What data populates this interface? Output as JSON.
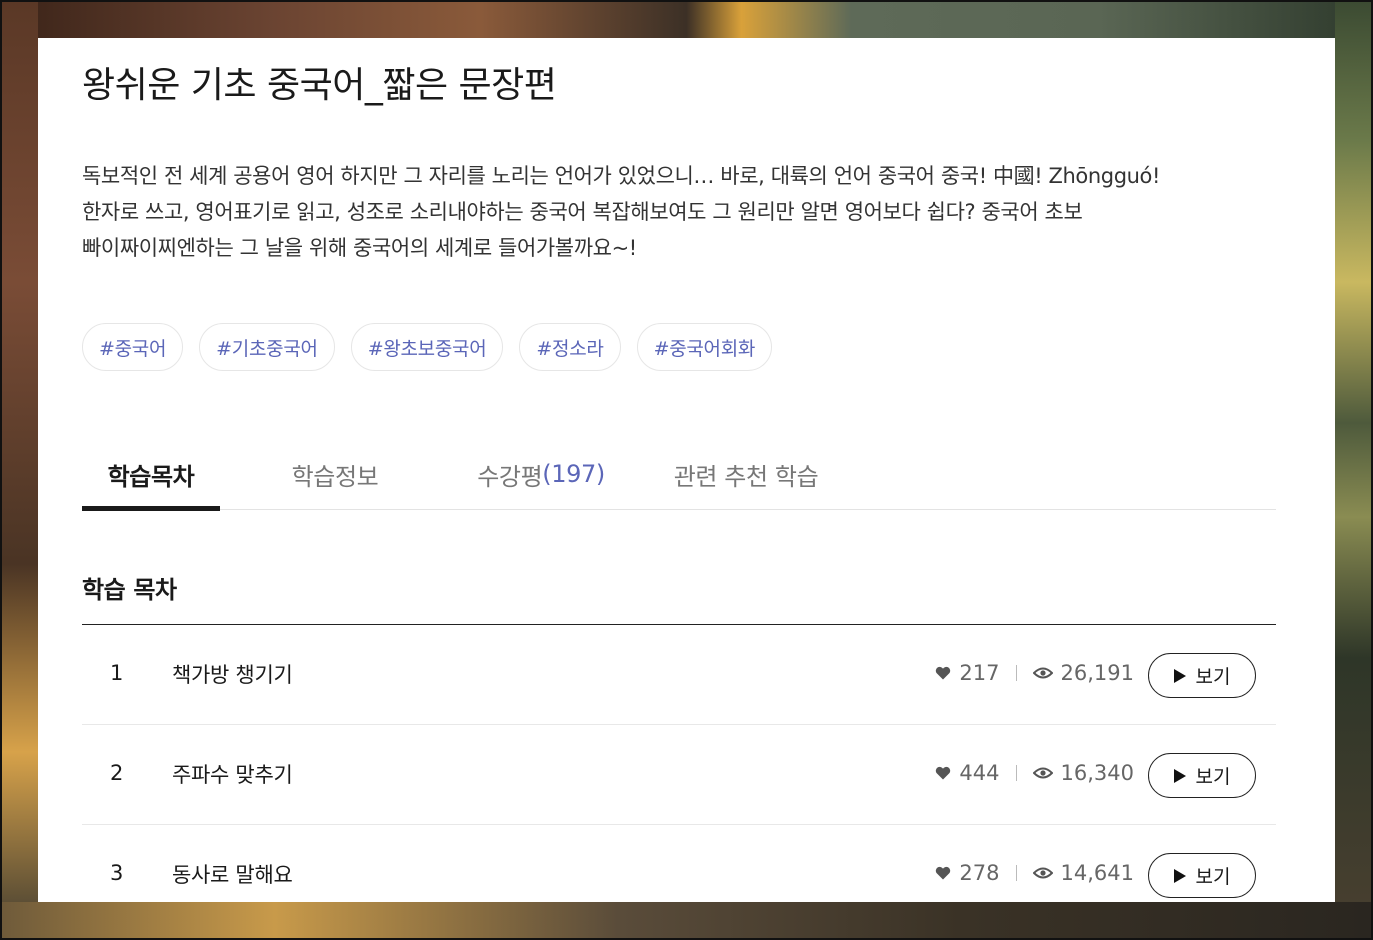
{
  "course": {
    "title": "왕쉬운 기초 중국어_짧은 문장편",
    "description_lines": [
      "독보적인 전 세계 공용어 영어 하지만 그 자리를 노리는 언어가 있었으니… 바로, 대륙의 언어 중국어 중국! 中國! Zhōngguó!",
      "한자로 쓰고, 영어표기로 읽고, 성조로 소리내야하는 중국어 복잡해보여도 그 원리만 알면 영어보다 쉽다? 중국어 초보",
      "빠이짜이찌엔하는 그 날을 위해 중국어의 세계로 들어가볼까요~!"
    ],
    "tags": [
      "#중국어",
      "#기초중국어",
      "#왕초보중국어",
      "#정소라",
      "#중국어회화"
    ]
  },
  "tabs": {
    "toc": "학습목차",
    "info": "학습정보",
    "reviews_label": "수강평",
    "reviews_count": "(197)",
    "related": "관련 추천 학습"
  },
  "toc": {
    "heading": "학습 목차",
    "view_label": "보기",
    "items": [
      {
        "num": "1",
        "name": "책가방 챙기기",
        "likes": "217",
        "views": "26,191"
      },
      {
        "num": "2",
        "name": "주파수 맞추기",
        "likes": "444",
        "views": "16,340"
      },
      {
        "num": "3",
        "name": "동사로 말해요",
        "likes": "278",
        "views": "14,641"
      }
    ]
  },
  "colors": {
    "accent": "#5b66b8",
    "text": "#1a1a1a"
  }
}
